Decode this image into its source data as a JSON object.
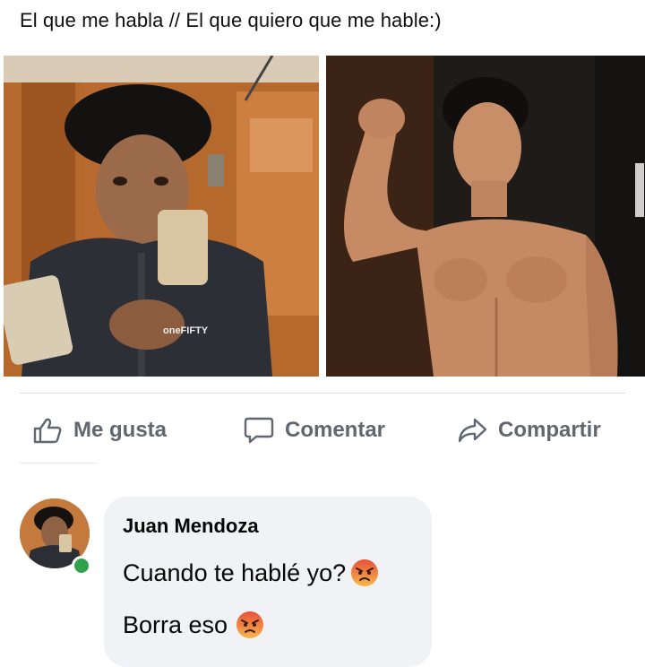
{
  "post": {
    "caption": "El que me habla // El que quiero que me hable:)",
    "photos": [
      "selfie-photo-left",
      "shirtless-photo-right"
    ]
  },
  "actions": {
    "like_label": "Me gusta",
    "comment_label": "Comentar",
    "share_label": "Compartir",
    "like_icon": "thumbs-up-icon",
    "comment_icon": "speech-bubble-icon",
    "share_icon": "share-arrow-icon"
  },
  "comment": {
    "author": "Juan Mendoza",
    "line1": "Cuando te hablé yo?",
    "line2": "Borra eso",
    "emoji": "angry-face-emoji",
    "online_color": "#31a24c"
  },
  "colors": {
    "action_text": "#606770",
    "bubble_bg": "#f0f2f5"
  }
}
